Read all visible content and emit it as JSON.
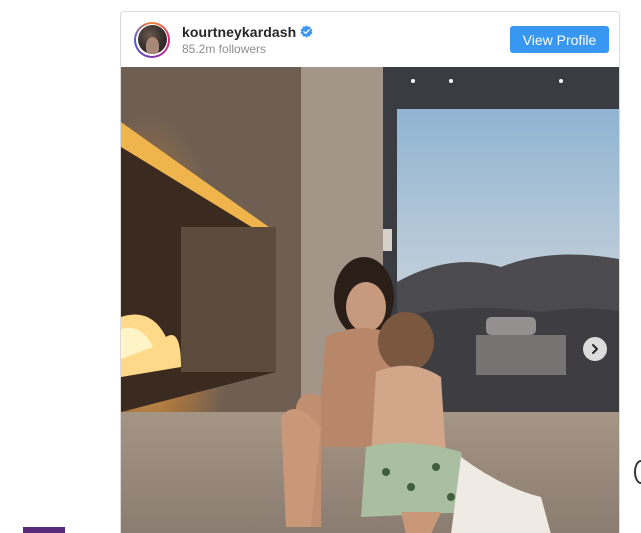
{
  "embed": {
    "username": "kourtneykardash",
    "followers": "85.2m followers",
    "view_profile_label": "View Profile",
    "verified": true,
    "accent_color": "#3897f0"
  },
  "post": {
    "image_alt": "",
    "carousel": {
      "next_icon": "chevron-right-icon"
    }
  },
  "icons": {
    "verified": "verified-badge-icon",
    "next": "chevron-right-icon"
  }
}
